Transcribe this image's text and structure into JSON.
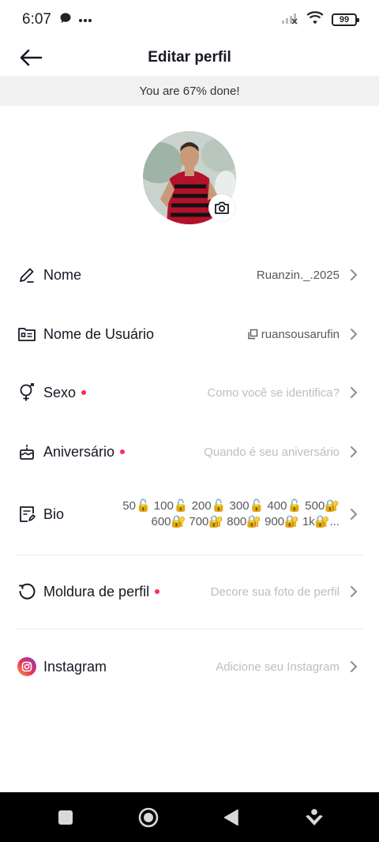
{
  "status_bar": {
    "time": "6:07",
    "left_icons": [
      "message-icon",
      "more-dots-icon"
    ],
    "right_icons": [
      "signal-off-icon",
      "wifi-icon"
    ],
    "battery": "99"
  },
  "header": {
    "back_icon": "arrow-left-icon",
    "title": "Editar perfil"
  },
  "progress": {
    "text": "You are 67% done!",
    "percent": 67
  },
  "avatar": {
    "edit_icon": "camera-icon"
  },
  "rows": {
    "name": {
      "icon": "pencil-icon",
      "label": "Nome",
      "value": "Ruanzin._.2025"
    },
    "username": {
      "icon": "id-card-icon",
      "label": "Nome de Usuário",
      "value": "ruansousarufin",
      "value_icon": "copy-icon"
    },
    "gender": {
      "icon": "gender-icon",
      "label": "Sexo",
      "value": "Como você se identifica?",
      "required": true
    },
    "birthday": {
      "icon": "cake-icon",
      "label": "Aniversário",
      "value": "Quando é seu aniversário",
      "required": true
    },
    "bio": {
      "icon": "bio-note-icon",
      "label": "Bio",
      "value_line1": "50🔓 100🔓 200🔓 300🔓 400🔓 500🔐",
      "value_line2": "600🔐 700🔐 800🔐 900🔐 1k🔐..."
    },
    "frame": {
      "icon": "frame-circle-icon",
      "label": "Moldura de perfil",
      "value": "Decore sua foto de perfil",
      "required": true
    },
    "instagram": {
      "icon": "instagram-icon",
      "label": "Instagram",
      "value": "Adicione seu Instagram"
    }
  },
  "nav": {
    "buttons": [
      "recent-apps-icon",
      "home-icon",
      "back-triangle-icon",
      "assistant-icon"
    ]
  },
  "colors": {
    "accent_red": "#fe2c55",
    "banner_bg": "#f1f1f2",
    "text_primary": "#161823",
    "text_placeholder": "#bdbdc2"
  }
}
